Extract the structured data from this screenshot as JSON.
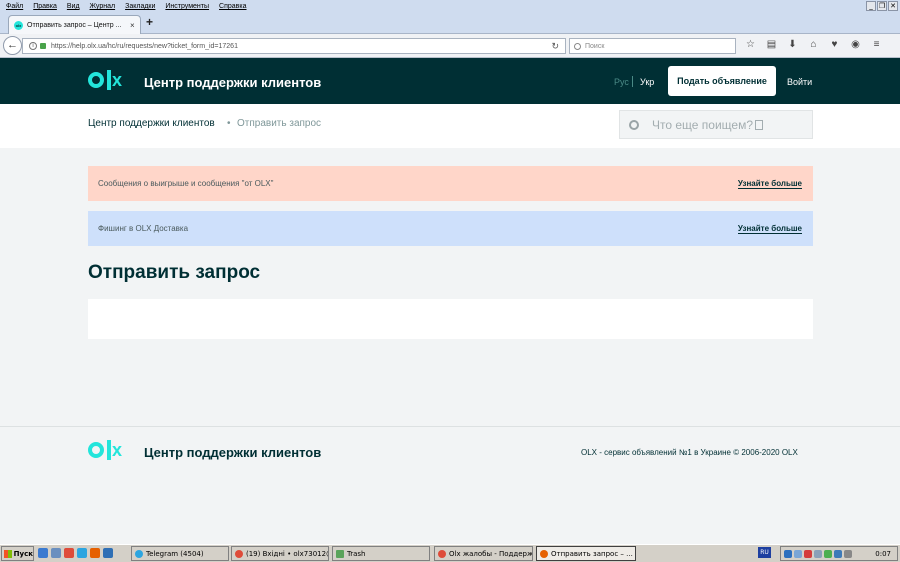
{
  "browser": {
    "menu": [
      "Файл",
      "Правка",
      "Вид",
      "Журнал",
      "Закладки",
      "Инструменты",
      "Справка"
    ],
    "tab_title": "Отправить запрос – Центр ...",
    "url": "https://help.olx.ua/hc/ru/requests/new?ticket_form_id=17261",
    "search_placeholder": "Поиск"
  },
  "header": {
    "site_title": "Центр поддержки клиентов",
    "lang_ru": "Рус",
    "lang_ua": "Укр",
    "post_ad": "Подать объявление",
    "login": "Войти"
  },
  "breadcrumb": {
    "home": "Центр поддержки клиентов",
    "separator": "•",
    "current": "Отправить запрос"
  },
  "search": {
    "placeholder": "Что еще поищем?"
  },
  "notices": [
    {
      "text": "Сообщения о выигрыше и сообщения \"от OLX\"",
      "link": "Узнайте больше",
      "color": "#ffd6c9"
    },
    {
      "text": "Фишинг в OLX Доставка",
      "link": "Узнайте больше",
      "color": "#cee0fb"
    }
  ],
  "page_title": "Отправить запрос",
  "footer": {
    "title": "Центр поддержки клиентов",
    "copyright": "OLX - сервис объявлений №1 в Украине © 2006-2020 OLX"
  },
  "taskbar": {
    "start": "Пуск",
    "tasks": [
      "Telegram (4504)",
      "(19) Вхідні • olx73012@...",
      "Trash",
      "Olx жалобы - Поддерж...",
      "Отправить запрос – ..."
    ],
    "lang": "RU",
    "clock": "0:07"
  },
  "colors": {
    "brand_dark": "#002f34",
    "brand_accent": "#23e5db"
  }
}
